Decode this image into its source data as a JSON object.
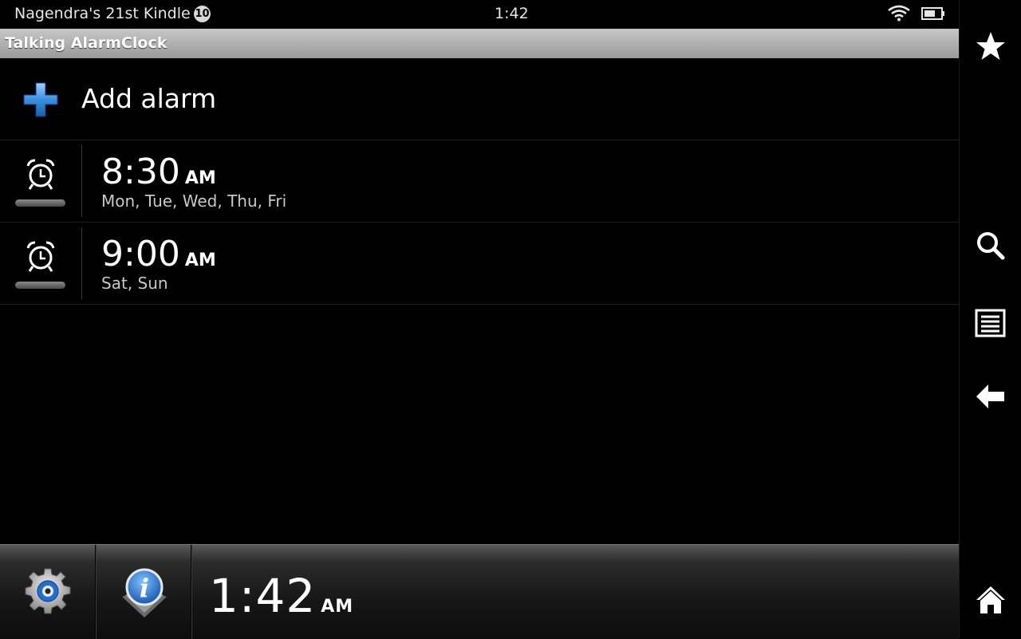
{
  "status_bar": {
    "device_name": "Nagendra's 21st Kindle",
    "notification_count": "10",
    "time": "1:42"
  },
  "title_bar": {
    "title": "Talking AlarmClock"
  },
  "add_alarm": {
    "label": "Add alarm",
    "icon": "plus-icon"
  },
  "alarms": [
    {
      "time": "8:30",
      "ampm": "AM",
      "days": "Mon, Tue, Wed, Thu, Fri",
      "icon": "alarm-clock-icon"
    },
    {
      "time": "9:00",
      "ampm": "AM",
      "days": "Sat, Sun",
      "icon": "alarm-clock-icon"
    }
  ],
  "bottom_bar": {
    "clock_time": "1:42",
    "clock_ampm": "AM",
    "buttons": [
      "settings-gear-icon",
      "info-icon"
    ]
  },
  "right_nav": [
    "favorites-star-icon",
    "search-icon",
    "menu-list-icon",
    "back-arrow-icon",
    "home-icon"
  ],
  "colors": {
    "background": "#000000",
    "title_bar": "#b0b0b0",
    "info_blue": "#2a7ad0",
    "plus_blue": "#3a8fe0"
  }
}
